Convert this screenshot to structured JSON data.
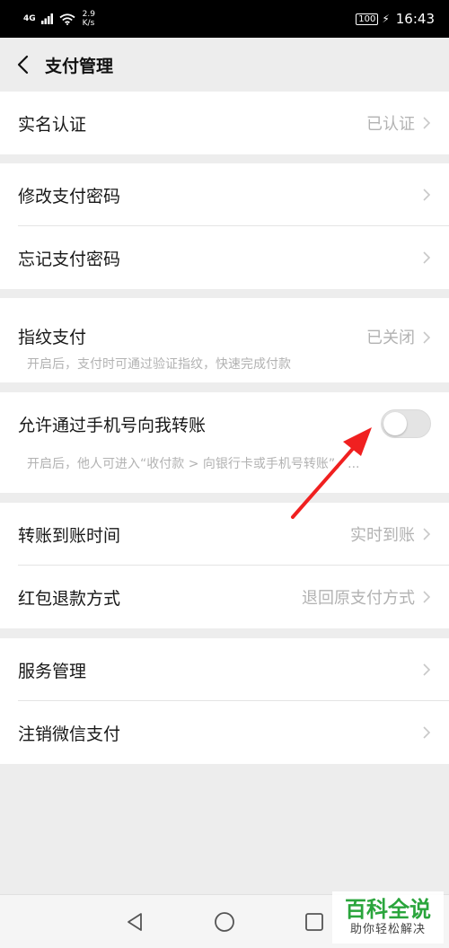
{
  "status_bar": {
    "network": "4G",
    "speed_value": "2.9",
    "speed_unit": "K/s",
    "battery": "100",
    "time": "16:43"
  },
  "header": {
    "title": "支付管理"
  },
  "groups": {
    "realname": {
      "label": "实名认证",
      "value": "已认证"
    },
    "password": {
      "modify_label": "修改支付密码",
      "forgot_label": "忘记支付密码"
    },
    "fingerprint": {
      "label": "指纹支付",
      "value": "已关闭",
      "desc": "开启后，支付时可通过验证指纹，快速完成付款"
    },
    "phone_transfer": {
      "label": "允许通过手机号向我转账",
      "desc": "开启后，他人可进入“收付款 > 向银行卡或手机号转账”，...",
      "enabled": false
    },
    "transfer": {
      "arrival_label": "转账到账时间",
      "arrival_value": "实时到账",
      "refund_label": "红包退款方式",
      "refund_value": "退回原支付方式"
    },
    "service": {
      "manage_label": "服务管理",
      "cancel_label": "注销微信支付"
    }
  },
  "colors": {
    "annotation_arrow": "#f02020",
    "watermark_green": "#2aa53c"
  },
  "watermark": {
    "title": "百科全说",
    "subtitle": "助你轻松解决"
  }
}
